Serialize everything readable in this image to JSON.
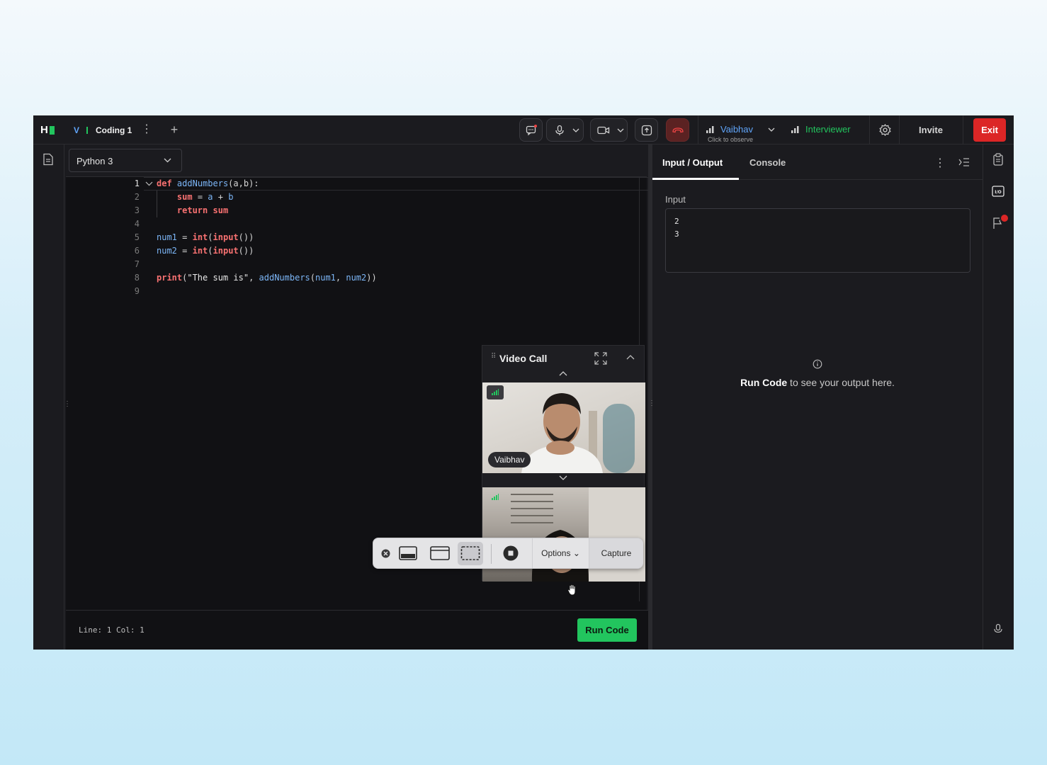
{
  "topbar": {
    "tab_indicator": "V",
    "tab_title": "Coding 1",
    "tab_more": "⋮",
    "tab_add": "+",
    "observer_name": "Vaibhav",
    "observer_sub": "Click to observe",
    "interviewer_label": "Interviewer",
    "invite_label": "Invite",
    "exit_label": "Exit"
  },
  "editor": {
    "language": "Python 3",
    "line_numbers": [
      "1",
      "2",
      "3",
      "4",
      "5",
      "6",
      "7",
      "8",
      "9"
    ],
    "lines": [
      [
        {
          "t": "def",
          "c": "kw"
        },
        {
          "t": " ",
          "c": "plain"
        },
        {
          "t": "addNumbers",
          "c": "fn"
        },
        {
          "t": "(a,b):",
          "c": "plain"
        }
      ],
      [
        {
          "t": "    ",
          "c": "plain"
        },
        {
          "t": "sum",
          "c": "kw"
        },
        {
          "t": " = ",
          "c": "plain"
        },
        {
          "t": "a",
          "c": "var"
        },
        {
          "t": " + ",
          "c": "plain"
        },
        {
          "t": "b",
          "c": "var"
        }
      ],
      [
        {
          "t": "    ",
          "c": "plain"
        },
        {
          "t": "return",
          "c": "kw"
        },
        {
          "t": " ",
          "c": "plain"
        },
        {
          "t": "sum",
          "c": "kw"
        }
      ],
      [],
      [
        {
          "t": "num1",
          "c": "var"
        },
        {
          "t": " = ",
          "c": "plain"
        },
        {
          "t": "int",
          "c": "kw"
        },
        {
          "t": "(",
          "c": "plain"
        },
        {
          "t": "input",
          "c": "kw"
        },
        {
          "t": "())",
          "c": "plain"
        }
      ],
      [
        {
          "t": "num2",
          "c": "var"
        },
        {
          "t": " = ",
          "c": "plain"
        },
        {
          "t": "int",
          "c": "kw"
        },
        {
          "t": "(",
          "c": "plain"
        },
        {
          "t": "input",
          "c": "kw"
        },
        {
          "t": "())",
          "c": "plain"
        }
      ],
      [],
      [
        {
          "t": "print",
          "c": "kw"
        },
        {
          "t": "(",
          "c": "plain"
        },
        {
          "t": "\"The sum is\"",
          "c": "str"
        },
        {
          "t": ", ",
          "c": "plain"
        },
        {
          "t": "addNumbers",
          "c": "fn"
        },
        {
          "t": "(",
          "c": "plain"
        },
        {
          "t": "num1",
          "c": "var"
        },
        {
          "t": ", ",
          "c": "plain"
        },
        {
          "t": "num2",
          "c": "var"
        },
        {
          "t": "))",
          "c": "plain"
        }
      ],
      []
    ],
    "status": "Line: 1 Col: 1",
    "run_label": "Run Code"
  },
  "right_panel": {
    "tabs": [
      "Input / Output",
      "Console"
    ],
    "active_tab": "Input / Output",
    "input_label": "Input",
    "input_lines": [
      "2",
      "3"
    ],
    "hint_bold": "Run Code",
    "hint_rest": " to see your output here."
  },
  "video_call": {
    "title": "Video Call",
    "participant_name": "Vaibhav"
  },
  "capture_bar": {
    "options_label": "Options ⌄",
    "capture_label": "Capture"
  },
  "colors": {
    "accent_green": "#22c55e",
    "accent_blue": "#60a5fa",
    "exit_red": "#dc2626",
    "keyword_red": "#f87171"
  },
  "icons": [
    "chat-icon",
    "mic-icon",
    "camera-icon",
    "share-screen-icon",
    "end-call-icon",
    "signal-icon",
    "gear-icon",
    "document-icon",
    "clipboard-icon",
    "io-icon",
    "flag-icon",
    "info-icon",
    "expand-icon",
    "chevron-up-icon",
    "chevron-down-icon",
    "close-icon",
    "hand-cursor-icon"
  ]
}
